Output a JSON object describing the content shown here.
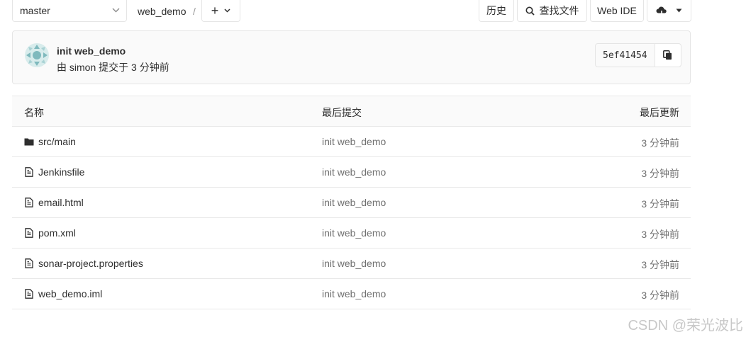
{
  "toolbar": {
    "branch": "master",
    "breadcrumb_project": "web_demo",
    "breadcrumb_sep": "/",
    "add_label": "+",
    "history_label": "历史",
    "find_file_label": "查找文件",
    "web_ide_label": "Web IDE"
  },
  "commit": {
    "title": "init web_demo",
    "meta": "由 simon 提交于 3 分钟前",
    "sha": "5ef41454"
  },
  "table": {
    "headers": {
      "name": "名称",
      "last_commit": "最后提交",
      "last_update": "最后更新"
    },
    "rows": [
      {
        "name": "src/main",
        "type": "folder",
        "commit": "init web_demo",
        "time": "3 分钟前"
      },
      {
        "name": "Jenkinsfile",
        "type": "file",
        "commit": "init web_demo",
        "time": "3 分钟前"
      },
      {
        "name": "email.html",
        "type": "file",
        "commit": "init web_demo",
        "time": "3 分钟前"
      },
      {
        "name": "pom.xml",
        "type": "file",
        "commit": "init web_demo",
        "time": "3 分钟前"
      },
      {
        "name": "sonar-project.properties",
        "type": "file",
        "commit": "init web_demo",
        "time": "3 分钟前"
      },
      {
        "name": "web_demo.iml",
        "type": "file",
        "commit": "init web_demo",
        "time": "3 分钟前"
      }
    ]
  },
  "watermark": "CSDN @荣光波比",
  "colors": {
    "border": "#e5e5e5",
    "muted_text": "#707070",
    "avatar": "#7fb9bd"
  }
}
